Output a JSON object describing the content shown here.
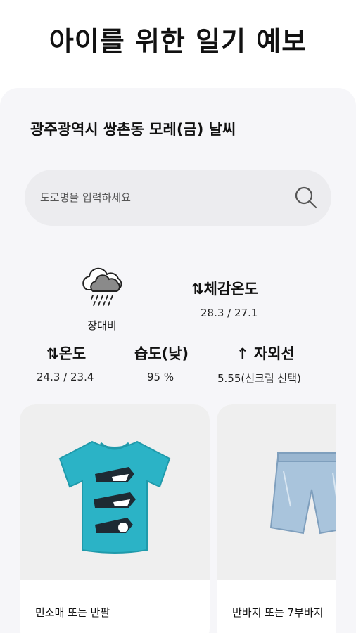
{
  "header": {
    "title": "아이를 위한 일기 예보"
  },
  "location": {
    "title": "광주광역시 쌍촌동 모레(금) 날씨"
  },
  "search": {
    "placeholder": "도로명을 입력하세요",
    "icon": "search-icon"
  },
  "weather": {
    "icon": "cloud-rain-icon",
    "condition": "장대비",
    "feels_like": {
      "label": "⇅체감온도",
      "value": "28.3 / 27.1"
    },
    "temperature": {
      "label": "⇅온도",
      "value": "24.3 / 23.4"
    },
    "humidity": {
      "label": "습도(낮)",
      "value": "95 %"
    },
    "uv": {
      "label": "↑ 자외선",
      "value": "5.55(선크림 선택)"
    }
  },
  "clothing": [
    {
      "label": "민소매 또는 반팔",
      "image": "tshirt-image",
      "color": "#2bb3c6"
    },
    {
      "label": "반바지 또는 7부바지",
      "image": "shorts-image",
      "color": "#a9c4dc"
    }
  ]
}
